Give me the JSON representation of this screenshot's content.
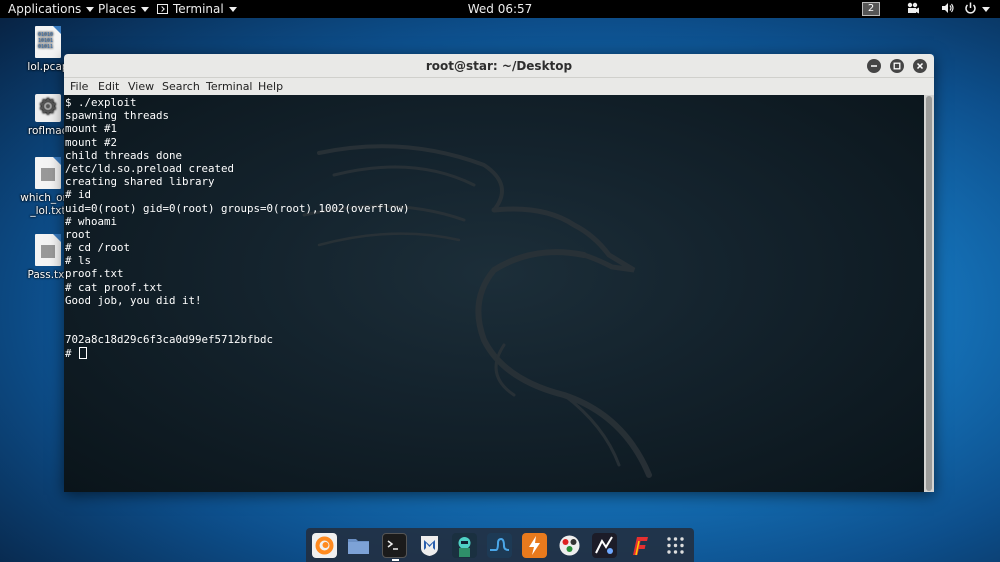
{
  "top_panel": {
    "applications_label": "Applications",
    "places_label": "Places",
    "terminal_label": "Terminal",
    "clock": "Wed 06:57",
    "workspace_number": "2"
  },
  "desktop_icons": [
    {
      "label": "lol.pcap",
      "icon": "binary-file-icon"
    },
    {
      "label": "roflmao",
      "icon": "gear-icon"
    },
    {
      "label": "which_one_lol.txt",
      "icon": "text-file-icon"
    },
    {
      "label": "Pass.txt",
      "icon": "text-file-icon"
    }
  ],
  "terminal": {
    "title": "root@star: ~/Desktop",
    "menu": [
      "File",
      "Edit",
      "View",
      "Search",
      "Terminal",
      "Help"
    ],
    "lines": [
      "$ ./exploit",
      "spawning threads",
      "mount #1",
      "mount #2",
      "child threads done",
      "/etc/ld.so.preload created",
      "creating shared library",
      "# id",
      "uid=0(root) gid=0(root) groups=0(root),1002(overflow)",
      "# whoami",
      "root",
      "# cd /root",
      "# ls",
      "proof.txt",
      "# cat proof.txt",
      "Good job, you did it!",
      "",
      "",
      "702a8c18d29c6f3ca0d99ef5712bfbdc",
      "# "
    ],
    "text_color": "#ffffff"
  },
  "dock": {
    "items": [
      "firefox-icon",
      "files-icon",
      "terminal-icon",
      "metasploit-icon",
      "armitage-icon",
      "burpsuite-icon",
      "maltego-icon",
      "beef-icon",
      "faraday-icon",
      "flashpoint-icon",
      "app-grid-icon"
    ],
    "active": "terminal-icon"
  },
  "colors": {
    "accent": "#1677bf",
    "panel": "#000000",
    "terminal_bg": "#14232d"
  }
}
